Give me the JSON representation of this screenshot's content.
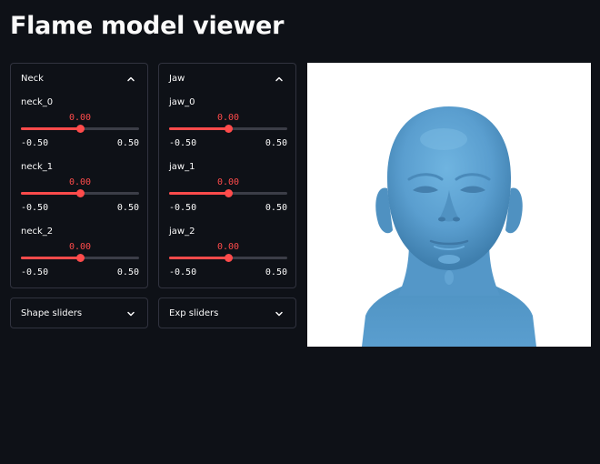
{
  "page": {
    "title": "Flame model viewer"
  },
  "neck": {
    "title": "Neck",
    "sliders": [
      {
        "label": "neck_0",
        "value": "0.00",
        "min": "-0.50",
        "max": "0.50",
        "fraction": 0.5
      },
      {
        "label": "neck_1",
        "value": "0.00",
        "min": "-0.50",
        "max": "0.50",
        "fraction": 0.5
      },
      {
        "label": "neck_2",
        "value": "0.00",
        "min": "-0.50",
        "max": "0.50",
        "fraction": 0.5
      }
    ]
  },
  "jaw": {
    "title": "Jaw",
    "sliders": [
      {
        "label": "jaw_0",
        "value": "0.00",
        "min": "-0.50",
        "max": "0.50",
        "fraction": 0.5
      },
      {
        "label": "jaw_1",
        "value": "0.00",
        "min": "-0.50",
        "max": "0.50",
        "fraction": 0.5
      },
      {
        "label": "jaw_2",
        "value": "0.00",
        "min": "-0.50",
        "max": "0.50",
        "fraction": 0.5
      }
    ]
  },
  "shape": {
    "title": "Shape sliders"
  },
  "exp": {
    "title": "Exp sliders"
  },
  "colors": {
    "background": "#0e1117",
    "accent": "#ff4b4b",
    "border": "#31333f",
    "mesh": "#5a9ecf"
  },
  "icons": {
    "expanded": "chevron-up-icon",
    "collapsed": "chevron-down-icon"
  }
}
